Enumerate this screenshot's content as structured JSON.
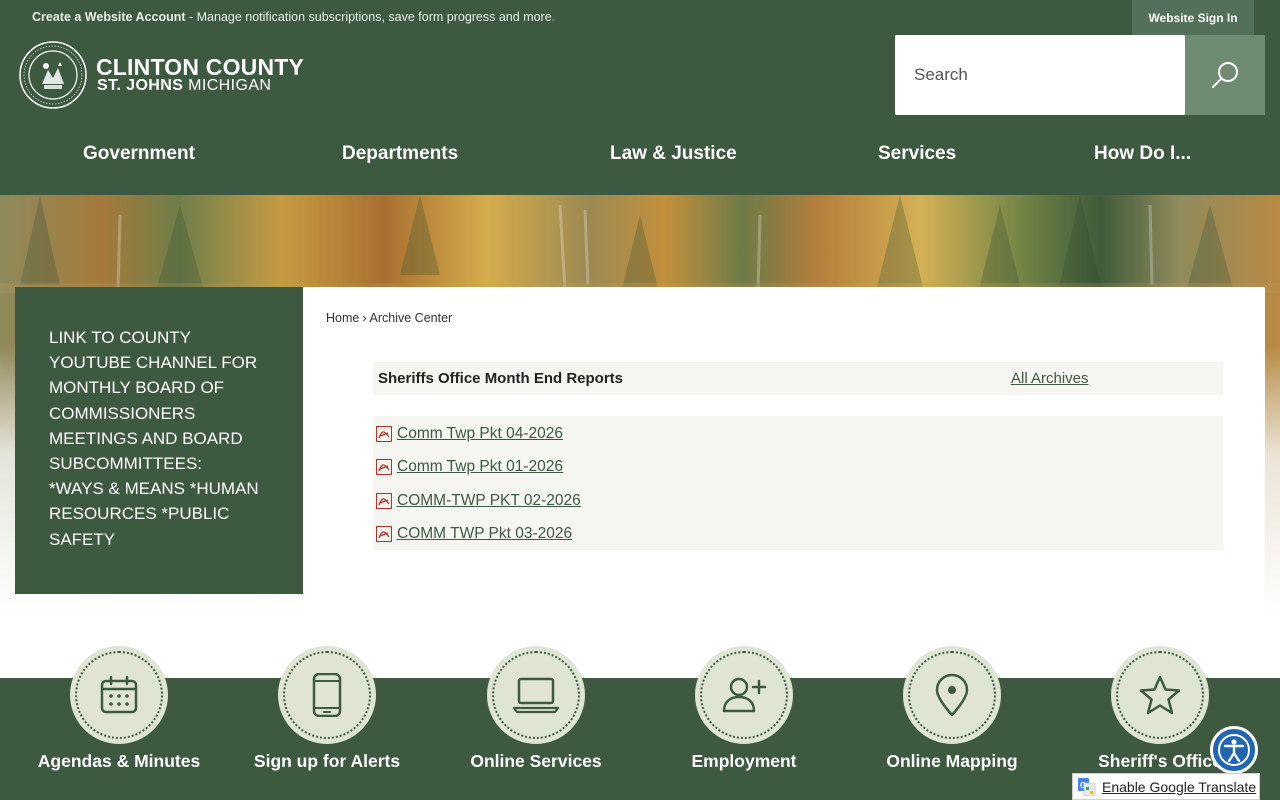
{
  "topbar": {
    "account_link": "Create a Website Account",
    "account_msg": " - Manage notification subscriptions, save form progress and more.",
    "signin": "Website Sign In"
  },
  "logo": {
    "line1": "CLINTON COUNTY",
    "line2_bold": "ST. JOHNS",
    "line2_rest": " MICHIGAN"
  },
  "search": {
    "placeholder": "Search"
  },
  "nav": {
    "items": [
      {
        "label": "Government"
      },
      {
        "label": "Departments"
      },
      {
        "label": "Law & Justice"
      },
      {
        "label": "Services"
      },
      {
        "label": "How Do I..."
      }
    ]
  },
  "sidebar": {
    "link": "LINK TO COUNTY YOUTUBE CHANNEL FOR MONTHLY BOARD OF COMMISSIONERS MEETINGS AND BOARD SUBCOMMITTEES: *WAYS & MEANS *HUMAN RESOURCES *PUBLIC SAFETY"
  },
  "breadcrumb": {
    "home": "Home",
    "separator": "›",
    "current": "Archive Center"
  },
  "archive": {
    "title": "Sheriffs Office Month End Reports",
    "all_archives": "All Archives",
    "documents": [
      {
        "label": "Comm Twp Pkt 04-2026"
      },
      {
        "label": "Comm Twp Pkt 01-2026"
      },
      {
        "label": "COMM-TWP PKT 02-2026"
      },
      {
        "label": "COMM TWP Pkt 03-2026"
      }
    ]
  },
  "quick_links": [
    {
      "label": "Agendas & Minutes",
      "icon": "calendar-icon"
    },
    {
      "label": "Sign up for Alerts",
      "icon": "phone-icon"
    },
    {
      "label": "Online Services",
      "icon": "laptop-icon"
    },
    {
      "label": "Employment",
      "icon": "add-user-icon"
    },
    {
      "label": "Online Mapping",
      "icon": "map-pin-icon"
    },
    {
      "label": "Sheriff's Office",
      "icon": "star-icon"
    }
  ],
  "translate": {
    "label": "Enable Google Translate"
  },
  "colors": {
    "brand_green": "#3d5a41",
    "search_button": "#6f8c73",
    "circle_fill": "#dfe4d3",
    "accessibility_blue": "#1f66b3"
  }
}
